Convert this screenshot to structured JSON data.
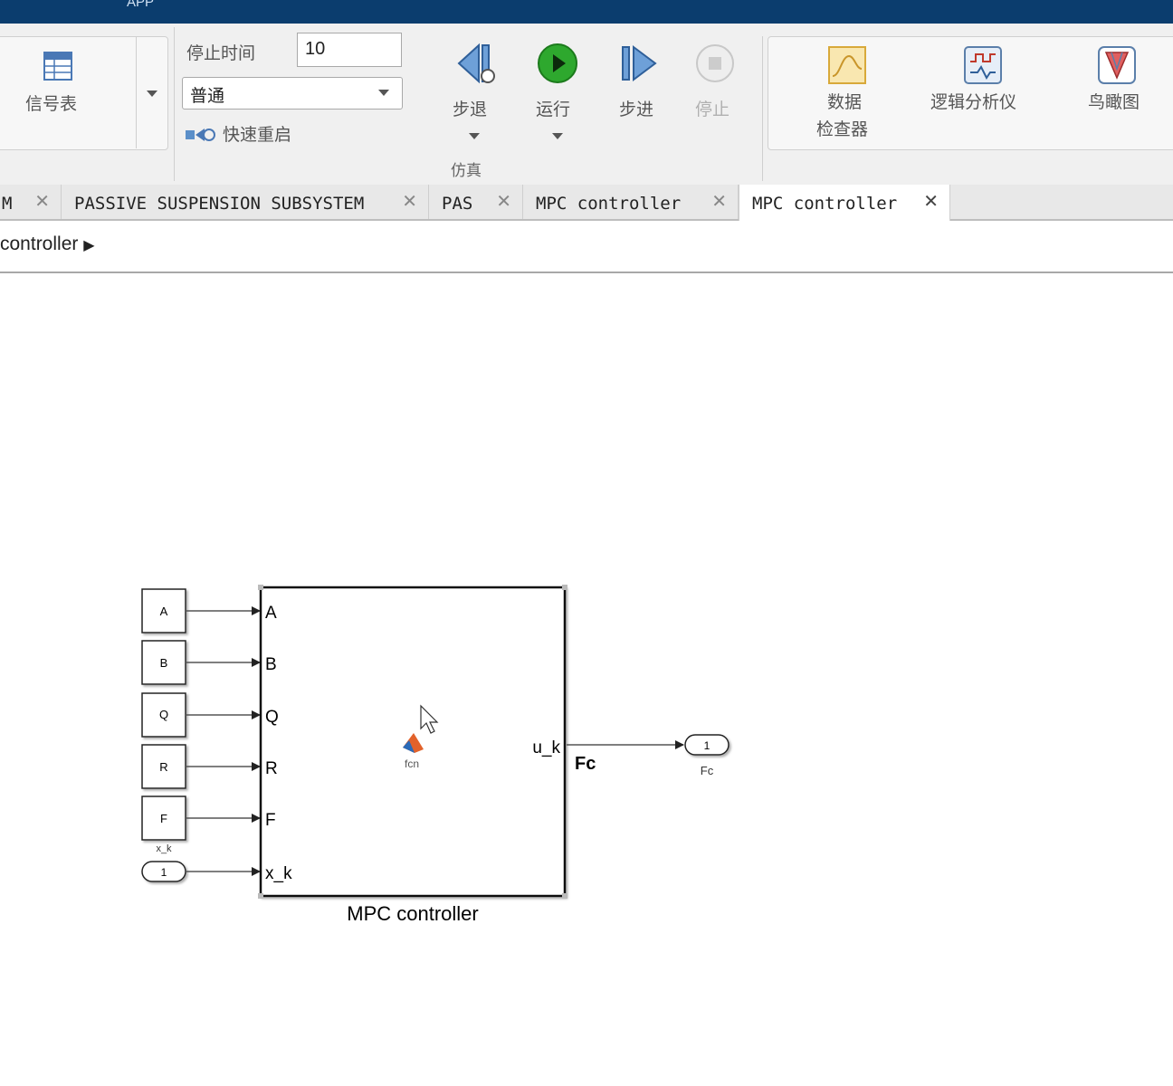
{
  "topbar": {
    "app_label": "APP"
  },
  "ribbon": {
    "signal_table": {
      "label": "信号表"
    },
    "stop_time": {
      "label": "停止时间",
      "value": "10"
    },
    "sim_mode": {
      "value": "普通"
    },
    "fast_restart": {
      "label": "快速重启"
    },
    "step_back": {
      "label": "步退"
    },
    "run": {
      "label": "运行"
    },
    "step_forward": {
      "label": "步进"
    },
    "stop": {
      "label": "停止"
    },
    "section_label": "仿真",
    "data_inspector": {
      "line1": "数据",
      "line2": "检查器"
    },
    "logic_analyzer": {
      "label": "逻辑分析仪"
    },
    "birds_eye": {
      "label": "鸟瞰图"
    }
  },
  "tabs": [
    {
      "label": "M"
    },
    {
      "label": "PASSIVE SUSPENSION SUBSYSTEM"
    },
    {
      "label": "PAS"
    },
    {
      "label": "MPC controller"
    },
    {
      "label": "MPC controller"
    }
  ],
  "breadcrumb": {
    "text": "controller"
  },
  "diagram": {
    "constants": [
      "A",
      "B",
      "Q",
      "R",
      "F"
    ],
    "inport": {
      "number": "1",
      "name": "x_k"
    },
    "subsystem": {
      "name": "MPC controller",
      "inputs": [
        "A",
        "B",
        "Q",
        "R",
        "F",
        "x_k"
      ],
      "output": "u_k",
      "icon_label": "fcn"
    },
    "signal_label": "Fc",
    "outport": {
      "number": "1",
      "name": "Fc"
    }
  },
  "colors": {
    "topbar": "#0b3d6e",
    "run_green": "#2ea82e",
    "matlab_orange": "#e2622b"
  }
}
